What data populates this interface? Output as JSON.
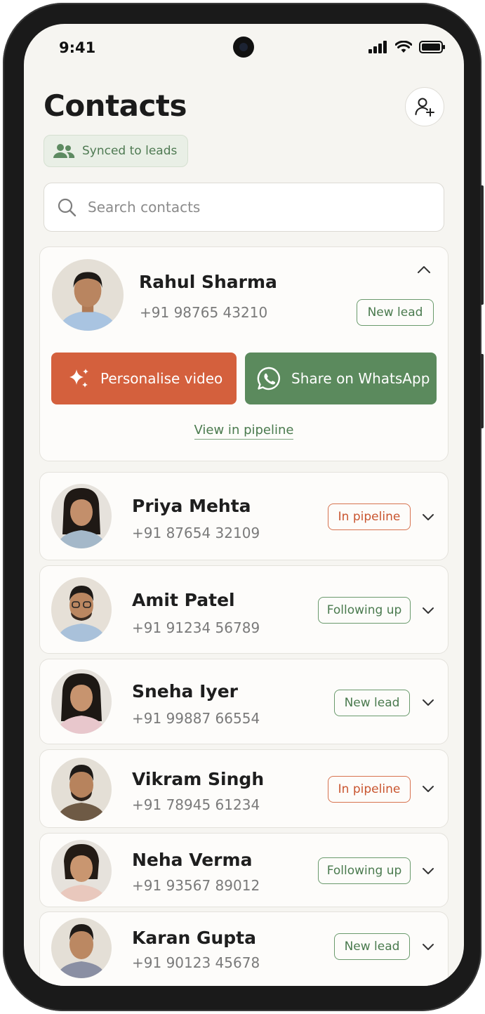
{
  "status_bar": {
    "time": "9:41"
  },
  "header": {
    "title": "Contacts",
    "sync_badge": "Synced to leads"
  },
  "search": {
    "placeholder": "Search contacts"
  },
  "expanded_contact": {
    "name": "Rahul Sharma",
    "phone": "+91 98765 43210",
    "status": "New lead",
    "actions": {
      "personalise_video": "Personalise video",
      "share_whatsapp": "Share on WhatsApp",
      "view_pipeline": "View in pipeline"
    }
  },
  "contacts": [
    {
      "name": "Priya Mehta",
      "phone": "+91 87654 32109",
      "status": "In pipeline"
    },
    {
      "name": "Amit Patel",
      "phone": "+91 91234 56789",
      "status": "Following up"
    },
    {
      "name": "Sneha Iyer",
      "phone": "+91 99887 66554",
      "status": "New lead"
    },
    {
      "name": "Vikram Singh",
      "phone": "+91 78945 61234",
      "status": "In pipeline"
    },
    {
      "name": "Neha Verma",
      "phone": "+91 93567 89012",
      "status": "Following up"
    },
    {
      "name": "Karan Gupta",
      "phone": "+91 90123 45678",
      "status": "New lead"
    }
  ],
  "colors": {
    "accent_orange": "#d4603d",
    "accent_green": "#5b8a5d",
    "background": "#f6f5f1"
  }
}
